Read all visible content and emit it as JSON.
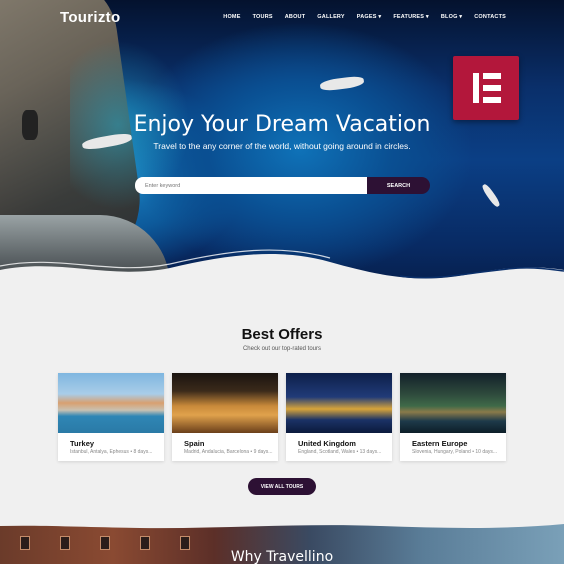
{
  "brand": {
    "name": "Tourizto"
  },
  "nav": {
    "items": [
      "HOME",
      "TOURS",
      "ABOUT",
      "GALLERY",
      "PAGES ▾",
      "FEATURES ▾",
      "BLOG ▾",
      "CONTACTS"
    ]
  },
  "hero": {
    "title": "Enjoy Your Dream Vacation",
    "subtitle": "Travel to the any corner of the world, without going around in circles.",
    "badge_icon": "elementor-logo-icon"
  },
  "search": {
    "placeholder": "Enter keyword",
    "button_label": "SEARCH"
  },
  "offers": {
    "title": "Best Offers",
    "subtitle": "Check out our top-rated tours",
    "cards": [
      {
        "name": "Turkey",
        "places": "Istanbul, Antalya, Ephesus • 8 days..."
      },
      {
        "name": "Spain",
        "places": "Madrid, Andalucia, Barcelona • 9 days..."
      },
      {
        "name": "United Kingdom",
        "places": "England, Scotland, Wales • 13 days..."
      },
      {
        "name": "Eastern Europe",
        "places": "Slovenia, Hungary, Poland • 10 days..."
      }
    ],
    "view_all_label": "VIEW ALL TOURS"
  },
  "why": {
    "title": "Why Travellino"
  },
  "colors": {
    "accent": "#2d1134",
    "badge": "#b3173b",
    "background": "#f0f0f0"
  }
}
